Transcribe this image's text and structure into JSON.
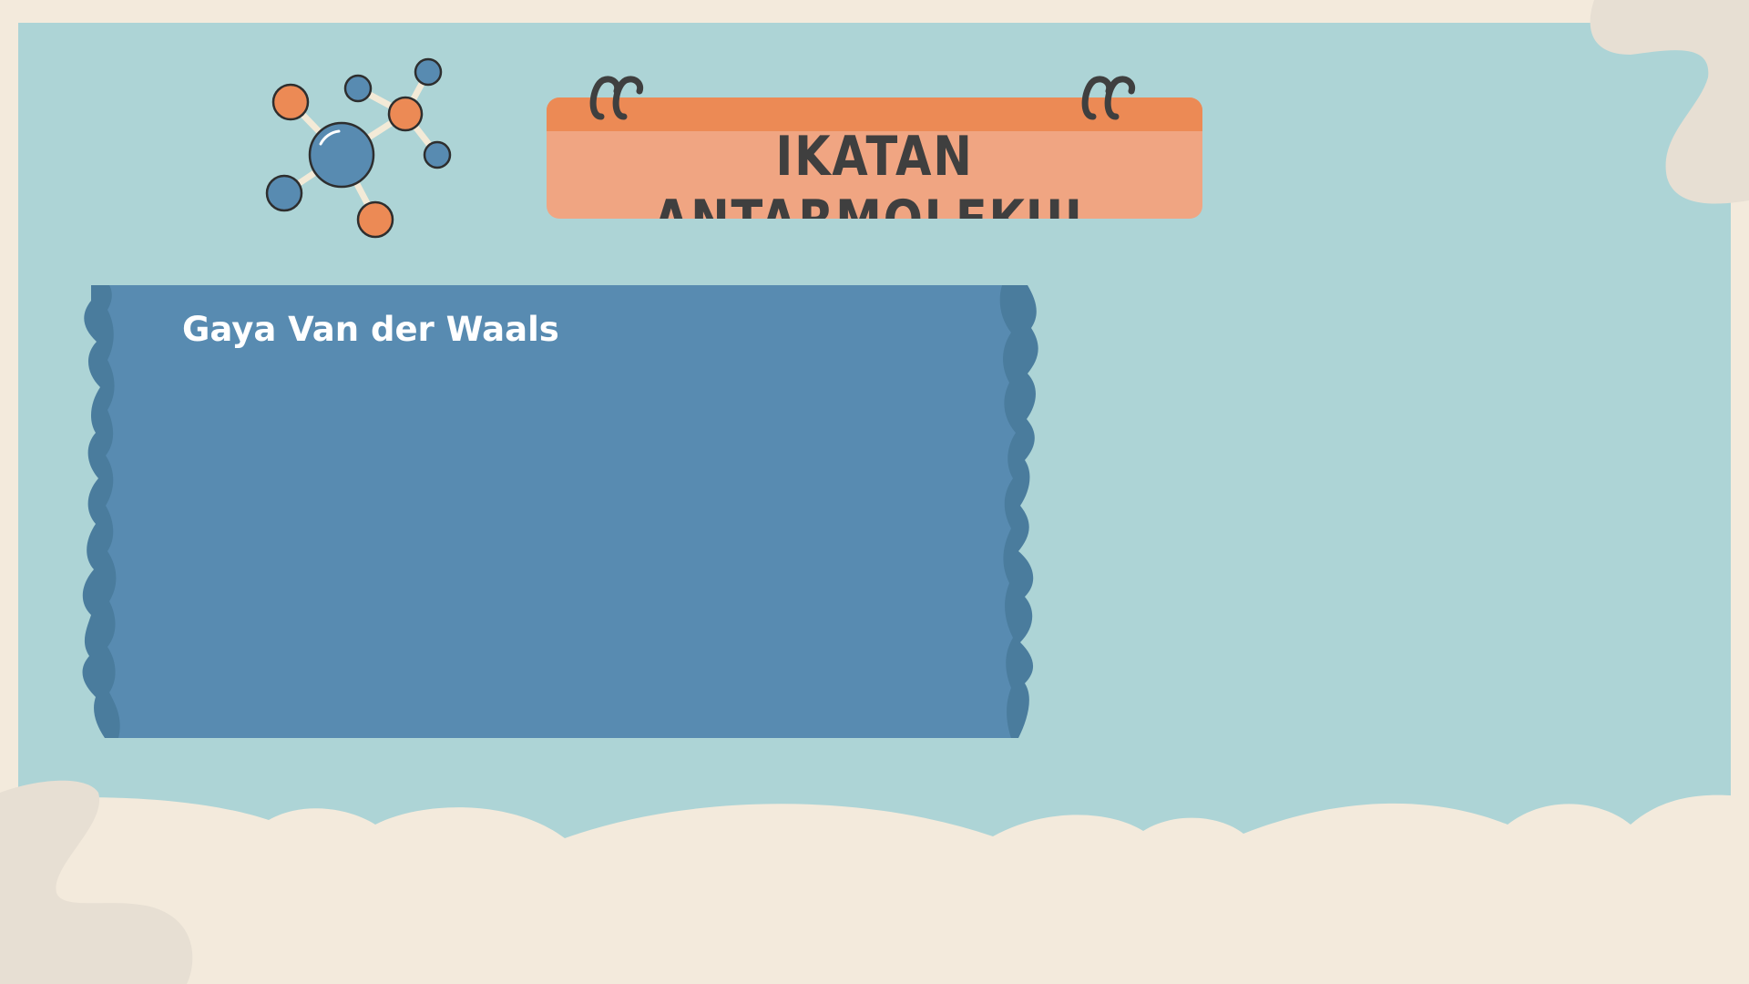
{
  "slide": {
    "title": "IKATAN ANTARMOLEKUL",
    "section_label": "Gaya Van der Waals"
  },
  "colors": {
    "background_cream": "#f3eadc",
    "panel_teal": "#add4d6",
    "ticket_blue": "#588bb1",
    "ticket_edge_blue": "#4a7c9d",
    "title_orange_band": "#ec8a55",
    "title_orange_body": "#f0a582",
    "molecule_orange": "#ec8a55",
    "molecule_blue": "#588bb1",
    "text_dark": "#3f3f3f"
  },
  "icons": [
    "molecule-icon",
    "binder-ring-icon"
  ]
}
